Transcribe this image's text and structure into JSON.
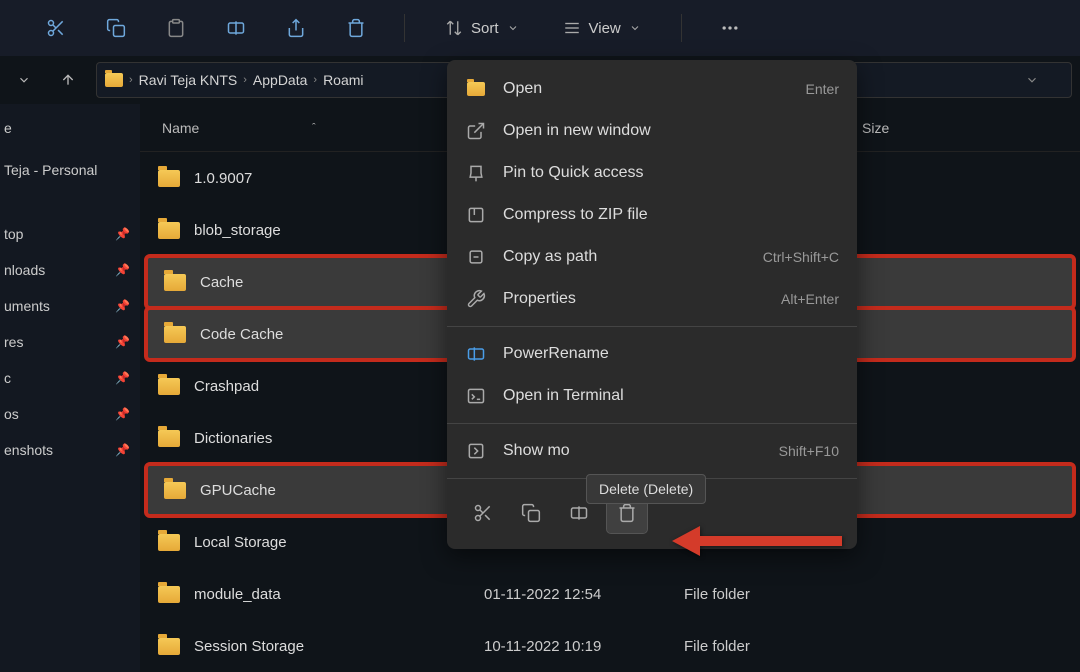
{
  "toolbar": {
    "sort_label": "Sort",
    "view_label": "View"
  },
  "breadcrumb": {
    "items": [
      "Ravi Teja KNTS",
      "AppData",
      "Roami"
    ]
  },
  "sidebar": {
    "header_e": "e",
    "personal": "Teja - Personal",
    "items": [
      {
        "label": "top"
      },
      {
        "label": "nloads"
      },
      {
        "label": "uments"
      },
      {
        "label": "res"
      },
      {
        "label": "c"
      },
      {
        "label": "os"
      },
      {
        "label": "enshots"
      }
    ]
  },
  "columns": {
    "name": "Name",
    "size": "Size"
  },
  "files": [
    {
      "name": "1.0.9007",
      "date": "",
      "type": "",
      "highlighted": false,
      "selected": false
    },
    {
      "name": "blob_storage",
      "date": "",
      "type": "",
      "highlighted": false,
      "selected": false
    },
    {
      "name": "Cache",
      "date": "",
      "type": "",
      "highlighted": true,
      "selected": true
    },
    {
      "name": "Code Cache",
      "date": "",
      "type": "",
      "highlighted": true,
      "selected": true
    },
    {
      "name": "Crashpad",
      "date": "",
      "type": "",
      "highlighted": false,
      "selected": false
    },
    {
      "name": "Dictionaries",
      "date": "",
      "type": "",
      "highlighted": false,
      "selected": false
    },
    {
      "name": "GPUCache",
      "date": "",
      "type": "",
      "highlighted": true,
      "selected": true
    },
    {
      "name": "Local Storage",
      "date": "",
      "type": "",
      "highlighted": false,
      "selected": false
    },
    {
      "name": "module_data",
      "date": "01-11-2022 12:54",
      "type": "File folder",
      "highlighted": false,
      "selected": false
    },
    {
      "name": "Session Storage",
      "date": "10-11-2022 10:19",
      "type": "File folder",
      "highlighted": false,
      "selected": false
    }
  ],
  "context_menu": {
    "items": [
      {
        "label": "Open",
        "shortcut": "Enter",
        "icon": "folder"
      },
      {
        "label": "Open in new window",
        "shortcut": "",
        "icon": "open-new"
      },
      {
        "label": "Pin to Quick access",
        "shortcut": "",
        "icon": "pin"
      },
      {
        "label": "Compress to ZIP file",
        "shortcut": "",
        "icon": "zip"
      },
      {
        "label": "Copy as path",
        "shortcut": "Ctrl+Shift+C",
        "icon": "copy-path"
      },
      {
        "label": "Properties",
        "shortcut": "Alt+Enter",
        "icon": "wrench"
      }
    ],
    "items2": [
      {
        "label": "PowerRename",
        "shortcut": "",
        "icon": "rename"
      },
      {
        "label": "Open in Terminal",
        "shortcut": "",
        "icon": "terminal"
      }
    ],
    "items3": [
      {
        "label": "Show mo",
        "shortcut": "Shift+F10",
        "icon": "more"
      }
    ]
  },
  "tooltip": {
    "text": "Delete (Delete)"
  }
}
